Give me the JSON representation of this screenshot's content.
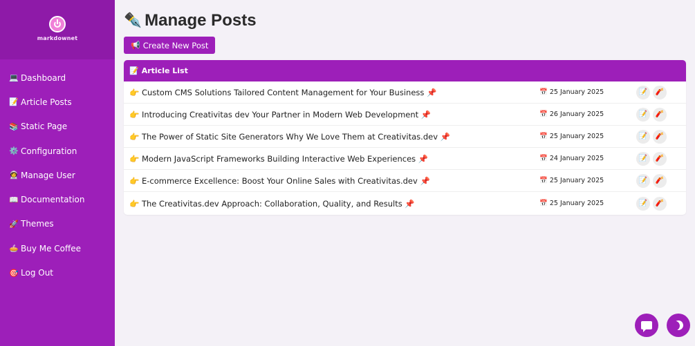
{
  "app": {
    "logo_text": "markdownet",
    "brand_color": "#9d1fb9",
    "logo_icon": "power-icon"
  },
  "sidebar": {
    "items": [
      {
        "icon": "💻",
        "icon_name": "laptop-icon",
        "label": "Dashboard"
      },
      {
        "icon": "📝",
        "icon_name": "memo-icon",
        "label": "Article Posts"
      },
      {
        "icon": "📚",
        "icon_name": "books-icon",
        "label": "Static Page"
      },
      {
        "icon": "⚙️",
        "icon_name": "gear-icon",
        "label": "Configuration"
      },
      {
        "icon": "🧑‍🚀",
        "icon_name": "user-icon",
        "label": "Manage User"
      },
      {
        "icon": "📖",
        "icon_name": "book-icon",
        "label": "Documentation"
      },
      {
        "icon": "🚀",
        "icon_name": "rocket-icon",
        "label": "Themes"
      },
      {
        "icon": "🥧",
        "icon_name": "coffee-icon",
        "label": "Buy Me Coffee"
      },
      {
        "icon": "🎯",
        "icon_name": "logout-icon",
        "label": "Log Out"
      }
    ]
  },
  "header": {
    "title_icon": "✒️",
    "title": "Manage Posts",
    "create_icon": "📢",
    "create_label": "Create New Post"
  },
  "list": {
    "header_icon": "📝",
    "header_label": "Article List",
    "date_icon": "📅",
    "edit_icon": "📝",
    "delete_icon": "🧨",
    "rows": [
      {
        "title": "👉 Custom CMS Solutions Tailored Content Management for Your Business 📌",
        "date": "25 January 2025"
      },
      {
        "title": "👉 Introducing Creativitas dev Your Partner in Modern Web Development 📌",
        "date": "26 January 2025"
      },
      {
        "title": "👉 The Power of Static Site Generators Why We Love Them at Creativitas.dev 📌",
        "date": "25 January 2025"
      },
      {
        "title": "👉 Modern JavaScript Frameworks Building Interactive Web Experiences 📌",
        "date": "24 January 2025"
      },
      {
        "title": "👉 E-commerce Excellence: Boost Your Online Sales with Creativitas.dev 📌",
        "date": "25 January 2025"
      },
      {
        "title": "👉 The Creativitas.dev Approach: Collaboration, Quality, and Results 📌",
        "date": "25 January 2025"
      }
    ]
  },
  "floating": {
    "chat_icon": "chat-icon",
    "theme_icon": "moon-icon"
  }
}
